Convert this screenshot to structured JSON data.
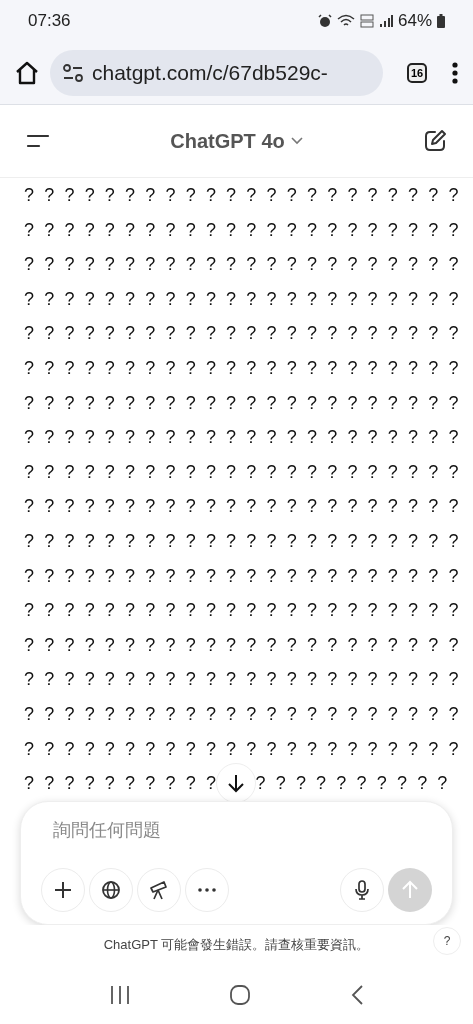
{
  "status_bar": {
    "time": "07:36",
    "battery": "64%"
  },
  "browser": {
    "url": "chatgpt.com/c/67db529c-",
    "tab_count": "16"
  },
  "header": {
    "title": "ChatGPT 4o"
  },
  "message": {
    "lines": [
      "? ? ? ? ? ? ? ? ? ? ? ? ? ? ? ? ? ? ? ? ? ?",
      "? ? ? ? ? ? ? ? ? ? ? ? ? ? ? ? ? ? ? ? ? ?",
      "? ? ? ? ? ? ? ? ? ? ? ? ? ? ? ? ? ? ? ? ? ?",
      "? ? ? ? ? ? ? ? ? ? ? ? ? ? ? ? ? ? ? ? ? ?",
      "? ? ? ? ? ? ? ? ? ? ? ? ? ? ? ? ? ? ? ? ? ?",
      "? ? ? ? ? ? ? ? ? ? ? ? ? ? ? ? ? ? ? ? ? ?",
      "? ? ? ? ? ? ? ? ? ? ? ? ? ? ? ? ? ? ? ? ? ?",
      "? ? ? ? ? ? ? ? ? ? ? ? ? ? ? ? ? ? ? ? ? ?",
      "? ? ? ? ? ? ? ? ? ? ? ? ? ? ? ? ? ? ? ? ? ?",
      "? ? ? ? ? ? ? ? ? ? ? ? ? ? ? ? ? ? ? ? ? ?",
      "? ? ? ? ? ? ? ? ? ? ? ? ? ? ? ? ? ? ? ? ? ?",
      "? ? ? ? ? ? ? ? ? ? ? ? ? ? ? ? ? ? ? ? ? ?",
      "? ? ? ? ? ? ? ? ? ? ? ? ? ? ? ? ? ? ? ? ? ?",
      "? ? ? ? ? ? ? ? ? ? ? ? ? ? ? ? ? ? ? ? ? ?",
      "? ? ? ? ? ? ? ? ? ? ? ? ? ? ? ? ? ? ? ? ? ?",
      "? ? ? ? ? ? ? ? ? ? ? ? ? ? ? ? ? ? ? ? ? ?",
      "? ? ? ? ? ? ? ? ? ? ? ? ? ? ? ? ? ? ? ? ? ?"
    ],
    "last_line": [
      "? ? ? ? ? ? ? ? ? ?",
      "? ? ? ? ? ? ? ? ? ?"
    ]
  },
  "composer": {
    "placeholder": "詢問任何問題",
    "send": {
      "disabled": true
    }
  },
  "disclaimer": "ChatGPT 可能會發生錯誤。請查核重要資訊。",
  "help": "?"
}
